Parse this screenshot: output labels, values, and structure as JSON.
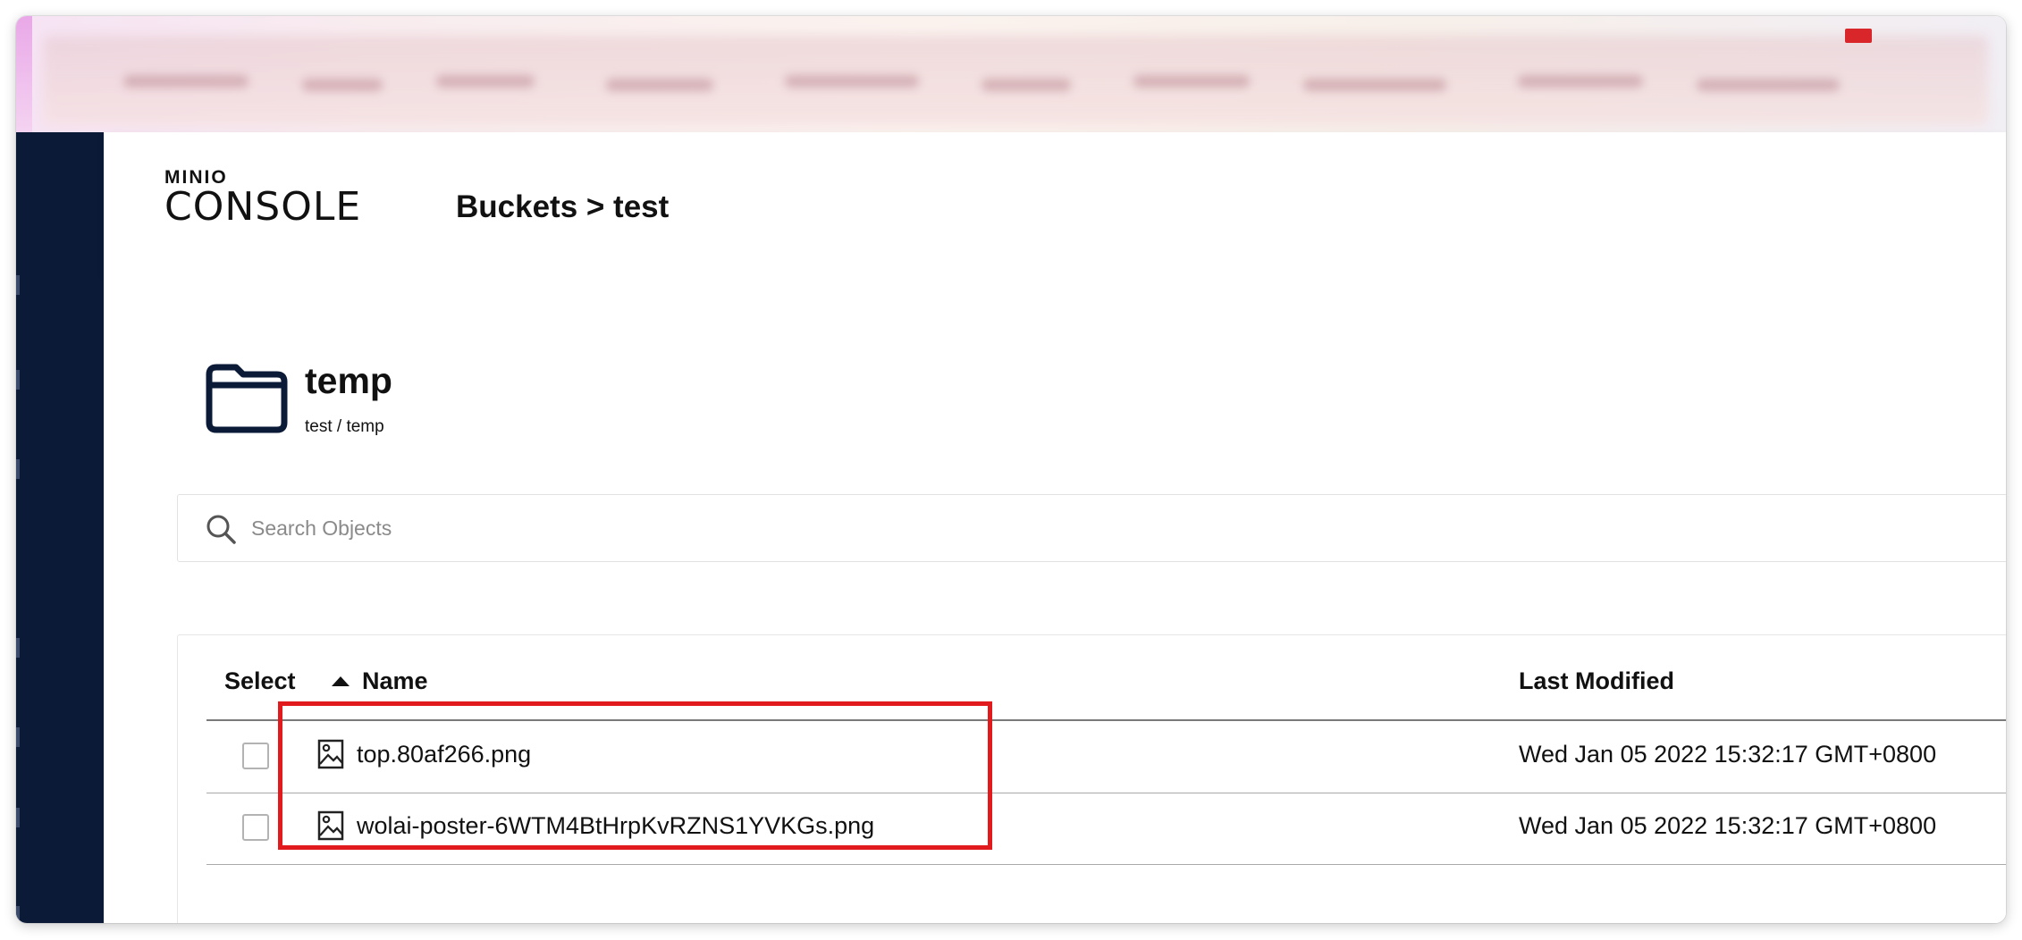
{
  "header": {
    "logo_top": "MINIO",
    "logo_main": "CONSOLE",
    "breadcrumb": "Buckets > test"
  },
  "folder": {
    "name": "temp",
    "path": "test / temp"
  },
  "search": {
    "placeholder": "Search Objects",
    "value": ""
  },
  "table": {
    "columns": {
      "select": "Select",
      "name": "Name",
      "modified": "Last Modified"
    },
    "sort": {
      "column": "Name",
      "direction": "ascending"
    },
    "rows": [
      {
        "name": "top.80af266.png",
        "modified": "Wed Jan 05 2022 15:32:17 GMT+0800",
        "type": "image-file-icon",
        "selected": false
      },
      {
        "name": "wolai-poster-6WTM4BtHrpKvRZNS1YVKGs.png",
        "modified": "Wed Jan 05 2022 15:32:17 GMT+0800",
        "type": "image-file-icon",
        "selected": false
      }
    ]
  },
  "colors": {
    "sidebar": "#0b1a37",
    "highlight": "#e01a1d"
  }
}
